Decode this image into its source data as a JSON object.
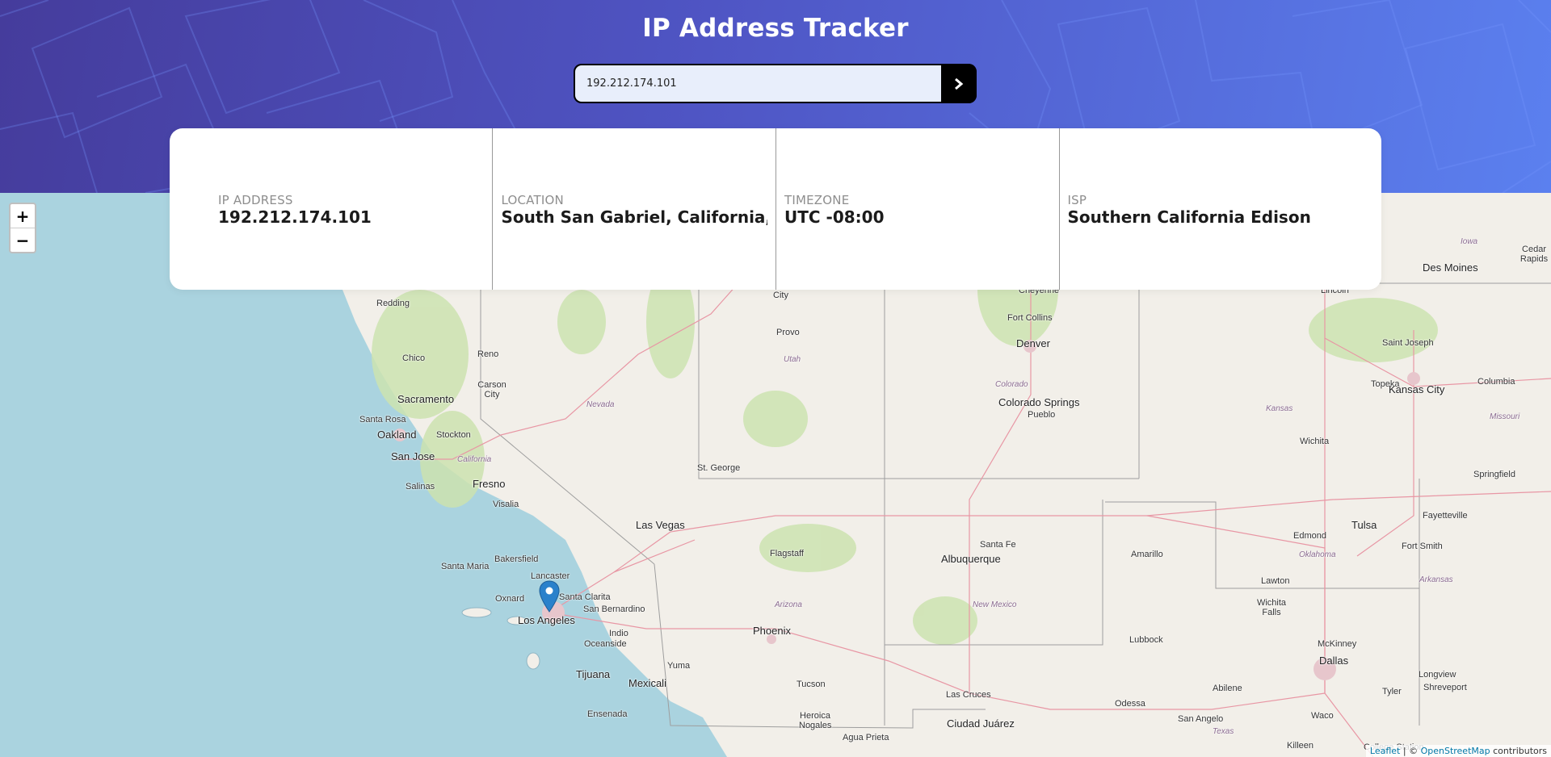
{
  "header": {
    "title": "IP Address Tracker",
    "search_value": "192.212.174.101",
    "search_button_icon": "chevron-right-icon"
  },
  "info": [
    {
      "label": "IP ADDRESS",
      "value": "192.212.174.101"
    },
    {
      "label": "LOCATION",
      "value": "South San Gabriel, California,"
    },
    {
      "label": "TIMEZONE",
      "value": "UTC -08:00"
    },
    {
      "label": "ISP",
      "value": "Southern California Edison"
    }
  ],
  "map": {
    "zoom_in": "+",
    "zoom_out": "−",
    "attribution": {
      "leaflet": "Leaflet",
      "sep": " | © ",
      "osm": "OpenStreetMap",
      "suffix": " contributors"
    },
    "places": [
      "Redding",
      "Chico",
      "Reno",
      "Carson City",
      "Sacramento",
      "Santa Rosa",
      "Oakland",
      "Stockton",
      "San Jose",
      "California",
      "Salinas",
      "Fresno",
      "Visalia",
      "Nevada",
      "Bakersfield",
      "Santa Maria",
      "Lancaster",
      "Oxnard",
      "Santa Clarita",
      "San Bernardino",
      "Los Angeles",
      "Indio",
      "Oceanside",
      "Tijuana",
      "Mexicali",
      "Yuma",
      "Ensenada",
      "Las Vegas",
      "St. George",
      "Provo",
      "Utah",
      "City",
      "Flagstaff",
      "Arizona",
      "Phoenix",
      "Tucson",
      "Heroica Nogales",
      "Agua Prieta",
      "Cheyenne",
      "Fort Collins",
      "Denver",
      "Colorado",
      "Colorado Springs",
      "Pueblo",
      "Santa Fe",
      "Albuquerque",
      "New Mexico",
      "Las Cruces",
      "Ciudad Juárez",
      "Lincoln",
      "Des Moines",
      "Cedar Rapids",
      "Iowa",
      "Saint Joseph",
      "Topeka",
      "Kansas City",
      "Columbia",
      "Kansas",
      "Missouri",
      "Wichita",
      "Springfield",
      "Amarillo",
      "Edmond",
      "Oklahoma",
      "Tulsa",
      "Fayetteville",
      "Fort Smith",
      "Lawton",
      "Wichita Falls",
      "Arkansas",
      "Lubbock",
      "McKinney",
      "Dallas",
      "Longview",
      "Tyler",
      "Shreveport",
      "Odessa",
      "Abilene",
      "Waco",
      "San Angelo",
      "Texas",
      "Killeen",
      "College Station"
    ]
  },
  "colors": {
    "header_start": "#453c9c",
    "header_end": "#5b80ef",
    "ocean": "#aad3df",
    "land": "#f2efe9",
    "marker": "#2a81cb"
  }
}
